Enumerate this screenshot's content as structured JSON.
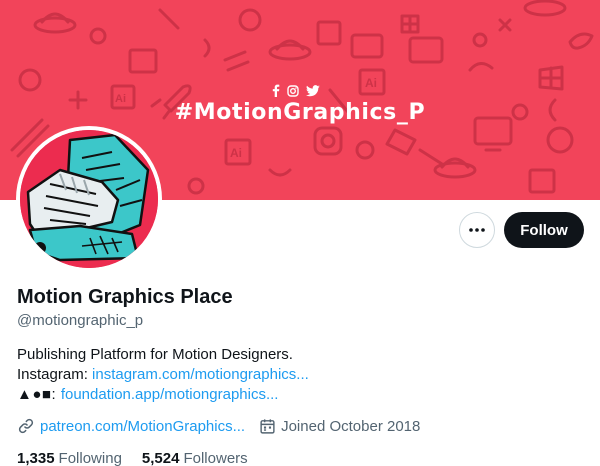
{
  "banner": {
    "hashtag": "#MotionGraphics_P",
    "background_color": "#f2445a",
    "social_icons": [
      "facebook-icon",
      "instagram-icon",
      "twitter-icon"
    ]
  },
  "avatar": {
    "background_color": "#ec2c4f"
  },
  "actions": {
    "more_icon": "more-horizontal-icon",
    "follow_label": "Follow"
  },
  "profile": {
    "display_name": "Motion Graphics Place",
    "handle": "@motiongraphic_p",
    "bio_line1": "Publishing Platform for Motion Designers.",
    "bio_line2_label": "Instagram: ",
    "bio_line2_link": "instagram.com/motiongraphics...",
    "bio_line3_label": "▲●■: ",
    "bio_line3_link": "foundation.app/motiongraphics..."
  },
  "meta": {
    "website": "patreon.com/MotionGraphics...",
    "joined": "Joined October 2018"
  },
  "stats": {
    "following_count": "1,335",
    "following_label": "Following",
    "followers_count": "5,524",
    "followers_label": "Followers"
  },
  "colors": {
    "link": "#1d9bf0",
    "text_primary": "#0f1419",
    "text_secondary": "#536471"
  }
}
